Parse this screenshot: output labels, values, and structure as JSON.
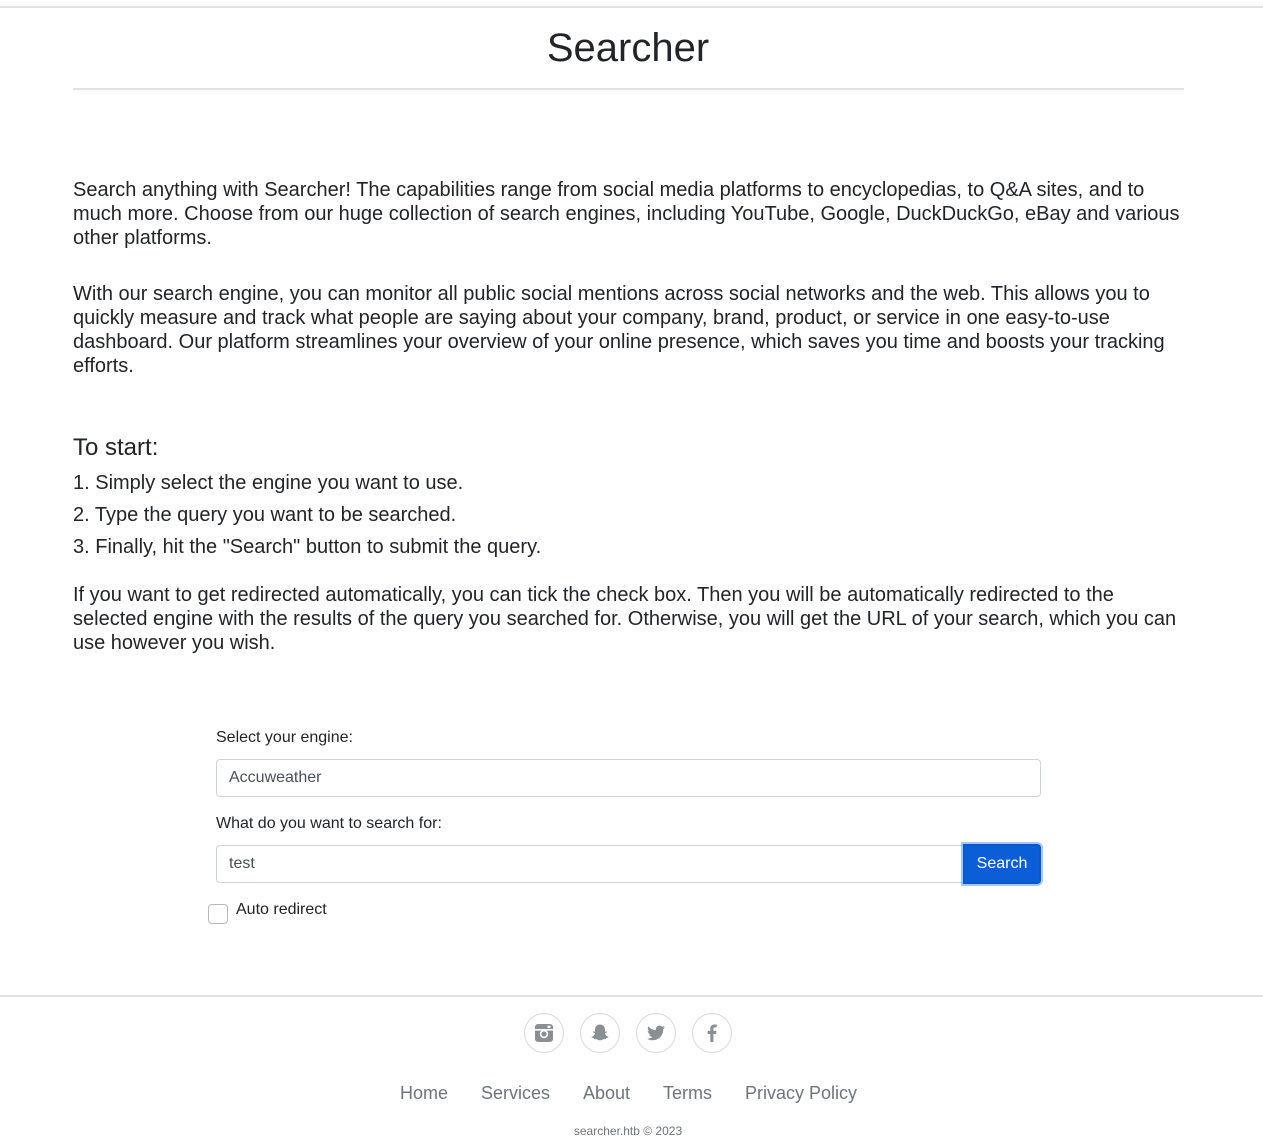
{
  "header": {
    "title": "Searcher"
  },
  "intro": {
    "paragraph1": "Search anything with Searcher! The capabilities range from social media platforms to encyclopedias, to Q&A sites, and to much more. Choose from our huge collection of search engines, including YouTube, Google, DuckDuckGo, eBay and various other platforms.",
    "paragraph2": "With our search engine, you can monitor all public social mentions across social networks and the web. This allows you to quickly measure and track what people are saying about your company, brand, product, or service in one easy-to-use dashboard. Our platform streamlines your overview of your online presence, which saves you time and boosts your tracking efforts."
  },
  "instructions": {
    "heading": "To start:",
    "steps": [
      "1. Simply select the engine you want to use.",
      "2. Type the query you want to be searched.",
      "3. Finally, hit the \"Search\" button to submit the query."
    ],
    "redirect_note": "If you want to get redirected automatically, you can tick the check box. Then you will be automatically redirected to the selected engine with the results of the query you searched for. Otherwise, you will get the URL of your search, which you can use however you wish."
  },
  "form": {
    "engine_label": "Select your engine:",
    "engine_value": "Accuweather",
    "query_label": "What do you want to search for:",
    "query_value": "test",
    "search_button": "Search",
    "auto_redirect_label": "Auto redirect",
    "auto_redirect_checked": false,
    "accent_color": "#0b5ed7"
  },
  "footer": {
    "social_icons": [
      "instagram-icon",
      "snapchat-icon",
      "twitter-icon",
      "facebook-icon"
    ],
    "nav": [
      "Home",
      "Services",
      "About",
      "Terms",
      "Privacy Policy"
    ],
    "copyright": "searcher.htb © 2023"
  }
}
